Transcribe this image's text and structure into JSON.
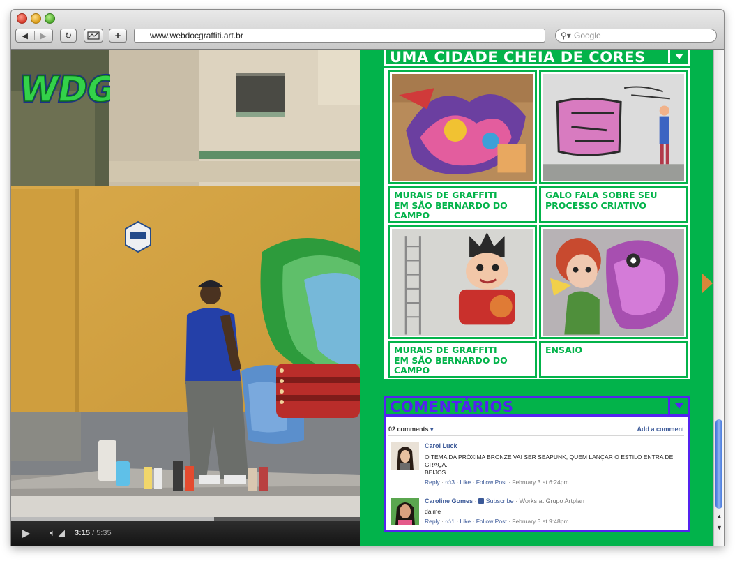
{
  "browser": {
    "url": "www.webdocgraffiti.art.br",
    "search_placeholder": "Google"
  },
  "video": {
    "logo_text": "WDG",
    "current_time": "3:15",
    "time_separator": "/",
    "duration": "5:35",
    "progress_fraction": 0.582
  },
  "gallery": {
    "title": "UMA CIDADE CHEIA DE CORES",
    "items": [
      {
        "caption": "MURAIS DE GRAFFITI\nEM SÃO BERNARDO DO\nCAMPO"
      },
      {
        "caption": "GALO FALA SOBRE SEU\nPROCESSO CRIATIVO"
      },
      {
        "caption": "MURAIS DE GRAFFITI\nEM SÃO BERNARDO DO\nCAMPO"
      },
      {
        "caption": "ENSAIO"
      }
    ]
  },
  "comments": {
    "title": "COMENTÁRIOS",
    "count": "02 comments",
    "add_label": "Add a comment",
    "list": [
      {
        "author": "Carol Luck",
        "text": "O TEMA DA PRÓXIMA BRONZE VAI SER SEAPUNK, QUEM LANÇAR O ESTILO ENTRA DE GRAÇA.",
        "text2": "BEIJOS",
        "reply": "Reply",
        "likes": "3",
        "like": "Like",
        "follow": "Follow Post",
        "date": "February 3 at 6:24pm"
      },
      {
        "author": "Caroline Gomes",
        "subscribe": "Subscribe",
        "workplace": "Works at Grupo Artplan",
        "text": "daime",
        "reply": "Reply",
        "likes": "1",
        "like": "Like",
        "follow": "Follow Post",
        "date": "February 3 at 9:48pm"
      }
    ]
  },
  "colors": {
    "panel_green": "#02b34b",
    "comments_purple": "#5423ef",
    "link_blue": "#3b5998",
    "arrow_orange": "#d9873a"
  }
}
